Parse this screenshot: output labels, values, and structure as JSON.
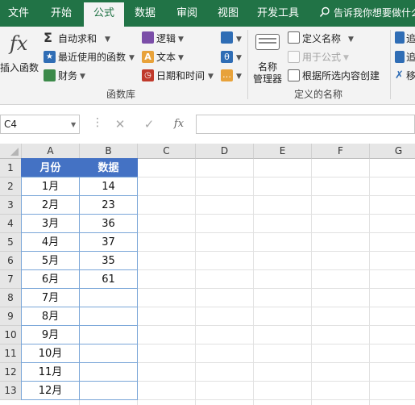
{
  "tabs": [
    "文件",
    "开始",
    "公式",
    "数据",
    "审阅",
    "视图",
    "开发工具"
  ],
  "active_tab": "公式",
  "tell_me": "告诉我你想要做什么",
  "ribbon": {
    "insert_function": {
      "icon": "fx",
      "label": "插入函数"
    },
    "autosum": "自动求和",
    "recently_used": "最近使用的函数",
    "financial": "财务",
    "logical": "逻辑",
    "text": "文本",
    "date_time": "日期和时间",
    "function_library_label": "函数库",
    "name_manager": {
      "line1": "名称",
      "line2": "管理器"
    },
    "define_name": "定义名称",
    "use_in_formula": "用于公式",
    "create_from_selection": "根据所选内容创建",
    "defined_names_label": "定义的名称",
    "trace_1": "追",
    "trace_2": "追",
    "trace_3": "移"
  },
  "formula_bar": {
    "name_box": "C4",
    "cancel": "✕",
    "enter": "✓",
    "fx": "fx",
    "content": ""
  },
  "grid": {
    "columns": [
      "A",
      "B",
      "C",
      "D",
      "E",
      "F",
      "G"
    ],
    "rows": [
      "1",
      "2",
      "3",
      "4",
      "5",
      "6",
      "7",
      "8",
      "9",
      "10",
      "11",
      "12",
      "13"
    ],
    "header": [
      "月份",
      "数据"
    ],
    "data": [
      [
        "1月",
        "14"
      ],
      [
        "2月",
        "23"
      ],
      [
        "3月",
        "36"
      ],
      [
        "4月",
        "37"
      ],
      [
        "5月",
        "35"
      ],
      [
        "6月",
        "61"
      ],
      [
        "7月",
        ""
      ],
      [
        "8月",
        ""
      ],
      [
        "9月",
        ""
      ],
      [
        "10月",
        ""
      ],
      [
        "11月",
        ""
      ],
      [
        "12月",
        ""
      ]
    ]
  },
  "colors": {
    "accent": "#217346",
    "table_header": "#4472c4"
  }
}
